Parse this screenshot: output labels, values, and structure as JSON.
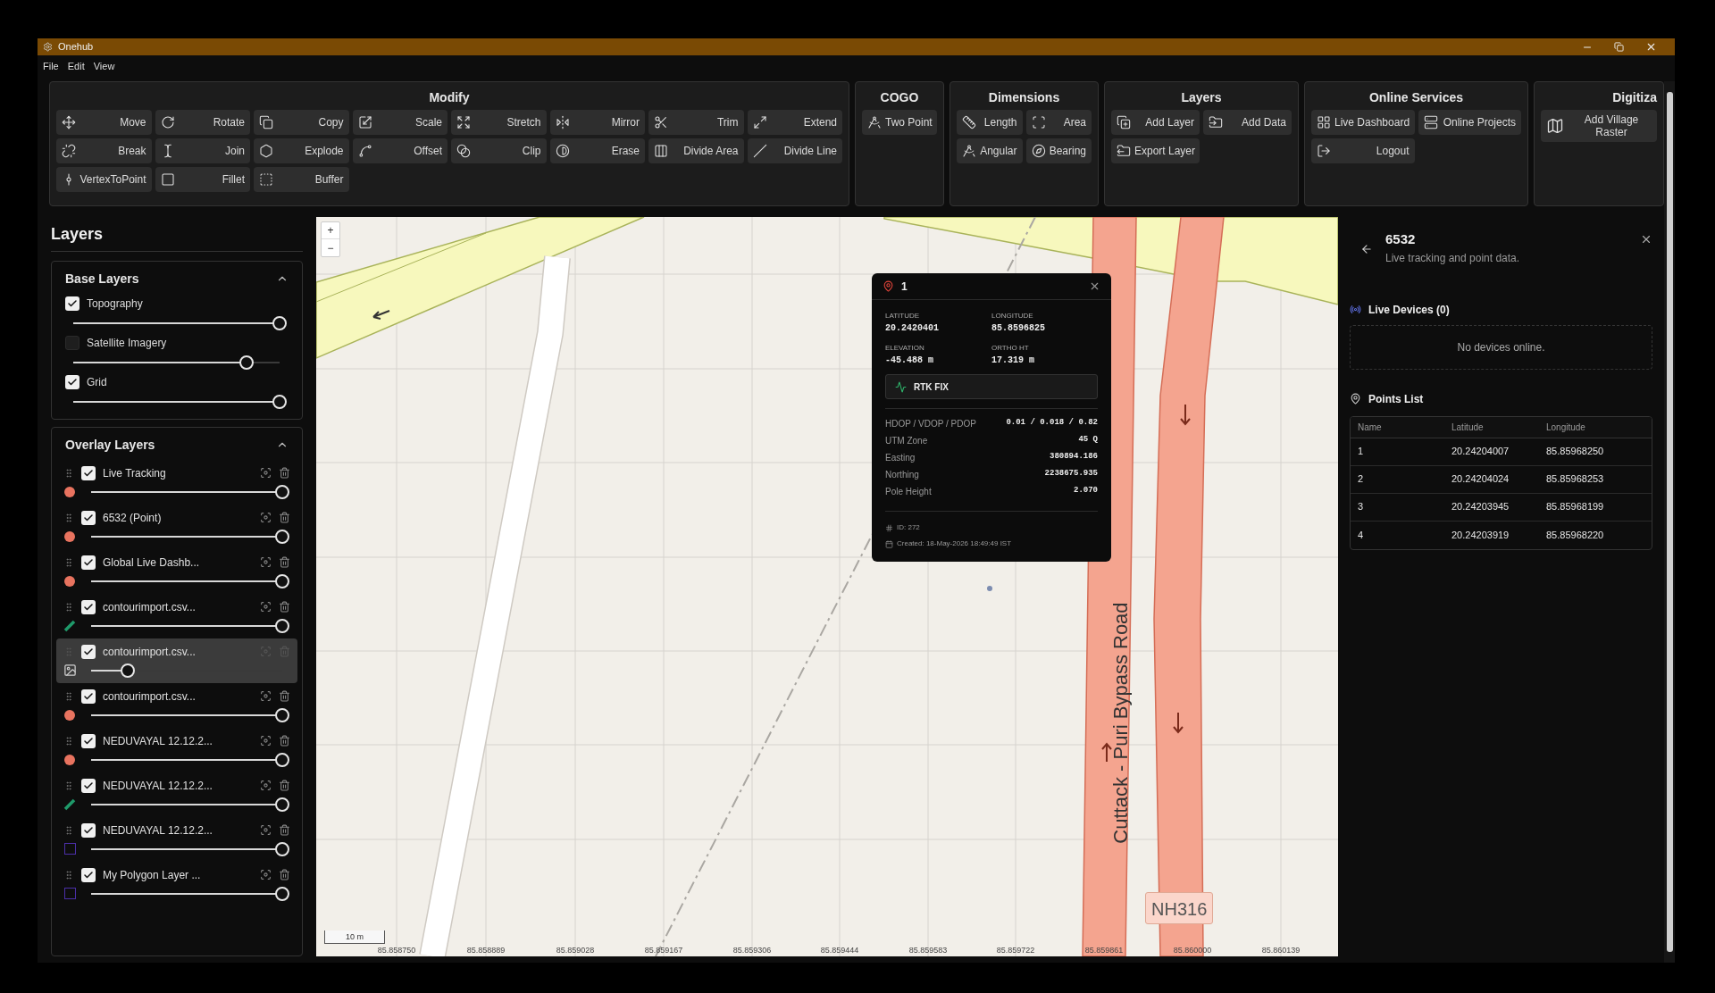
{
  "window": {
    "title": "Onehub"
  },
  "menu": [
    "File",
    "Edit",
    "View"
  ],
  "ribbon": [
    {
      "title": "Modify",
      "buttons": [
        "Move",
        "Rotate",
        "Copy",
        "Scale",
        "Stretch",
        "Mirror",
        "Trim",
        "Extend",
        "Break",
        "Join",
        "Explode",
        "Offset",
        "Clip",
        "Erase",
        "Divide Area",
        "Divide Line",
        "VertexToPoint",
        "Fillet",
        "Buffer"
      ]
    },
    {
      "title": "COGO",
      "buttons": [
        "Two Point"
      ]
    },
    {
      "title": "Dimensions",
      "buttons": [
        "Length",
        "Area",
        "Angular",
        "Bearing"
      ]
    },
    {
      "title": "Layers",
      "buttons": [
        "Add Layer",
        "Add Data",
        "Export Layer"
      ]
    },
    {
      "title": "Online Services",
      "buttons": [
        "Live Dashboard",
        "Online Projects",
        "Logout"
      ]
    },
    {
      "title": "Digitiza",
      "buttons": [
        "Add Village Raster"
      ]
    }
  ],
  "layers_panel": {
    "title": "Layers",
    "sections": [
      {
        "title": "Base Layers",
        "expanded": true,
        "layers": [
          {
            "name": "Topography",
            "checked": true,
            "level": 1
          },
          {
            "name": "Satellite Imagery",
            "checked": false,
            "level": 0.84
          },
          {
            "name": "Grid",
            "checked": true,
            "level": 1
          }
        ]
      },
      {
        "title": "Overlay Layers",
        "expanded": true,
        "layers": [
          {
            "name": "Live Tracking",
            "checked": true,
            "level": 1,
            "kind": "point",
            "color": "#e8735f",
            "selected": false
          },
          {
            "name": "6532 (Point)",
            "checked": true,
            "level": 1,
            "kind": "point",
            "color": "#e8735f",
            "selected": false
          },
          {
            "name": "Global Live Dashb...",
            "checked": true,
            "level": 1,
            "kind": "point",
            "color": "#e8735f",
            "selected": false
          },
          {
            "name": "contourimport.csv...",
            "checked": true,
            "level": 1,
            "kind": "line",
            "color": "#1f9a6a",
            "selected": false
          },
          {
            "name": "contourimport.csv...",
            "checked": true,
            "level": 0.19,
            "kind": "image",
            "selected": true
          },
          {
            "name": "contourimport.csv...",
            "checked": true,
            "level": 1,
            "kind": "point",
            "color": "#e8735f",
            "selected": false
          },
          {
            "name": "NEDUVAYAL 12.12.2...",
            "checked": true,
            "level": 1,
            "kind": "point",
            "color": "#e8735f",
            "selected": false
          },
          {
            "name": "NEDUVAYAL 12.12.2...",
            "checked": true,
            "level": 1,
            "kind": "line",
            "color": "#1f9a6a",
            "selected": false
          },
          {
            "name": "NEDUVAYAL 12.12.2...",
            "checked": true,
            "level": 1,
            "kind": "polygon",
            "color": "#4b2fa8",
            "selected": false
          },
          {
            "name": "My Polygon Layer ...",
            "checked": true,
            "level": 1,
            "kind": "polygon",
            "color": "#4b2fa8",
            "selected": false
          }
        ]
      }
    ]
  },
  "map": {
    "zoom_in": "+",
    "zoom_out": "−",
    "road_label": "Cuttack - Puri Bypass Road",
    "route_badge": "NH316",
    "scale": "10 m",
    "x_axis": [
      "85.858750",
      "85.858889",
      "85.859028",
      "85.859167",
      "85.859306",
      "85.859444",
      "85.859583",
      "85.859722",
      "85.859861",
      "85.860000",
      "85.860139"
    ],
    "popup": {
      "title": "1",
      "fields": [
        {
          "label": "LATITUDE",
          "value": "20.2420401"
        },
        {
          "label": "LONGITUDE",
          "value": "85.8596825"
        },
        {
          "label": "ELEVATION",
          "value": "-45.488 m"
        },
        {
          "label": "ORTHO HT",
          "value": "17.319 m"
        }
      ],
      "status": "RTK FIX",
      "details": [
        {
          "label": "HDOP / VDOP / PDOP",
          "value": "0.01 / 0.018 / 0.82"
        },
        {
          "label": "UTM Zone",
          "value": "45 Q"
        },
        {
          "label": "Easting",
          "value": "380894.186"
        },
        {
          "label": "Northing",
          "value": "2238675.935"
        },
        {
          "label": "Pole Height",
          "value": "2.070"
        }
      ],
      "id": "ID: 272",
      "created": "Created: 18-May-2026 18:49:49 IST"
    }
  },
  "details_panel": {
    "title": "6532",
    "subtitle": "Live tracking and point data.",
    "live_devices": {
      "title": "Live Devices (0)",
      "empty": "No devices online."
    },
    "points": {
      "title": "Points List",
      "columns": [
        "Name",
        "Latitude",
        "Longitude"
      ],
      "rows": [
        [
          "1",
          "20.24204007",
          "85.85968250"
        ],
        [
          "2",
          "20.24204024",
          "85.85968253"
        ],
        [
          "3",
          "20.24203945",
          "85.85968199"
        ],
        [
          "4",
          "20.24203919",
          "85.85968220"
        ]
      ]
    }
  }
}
